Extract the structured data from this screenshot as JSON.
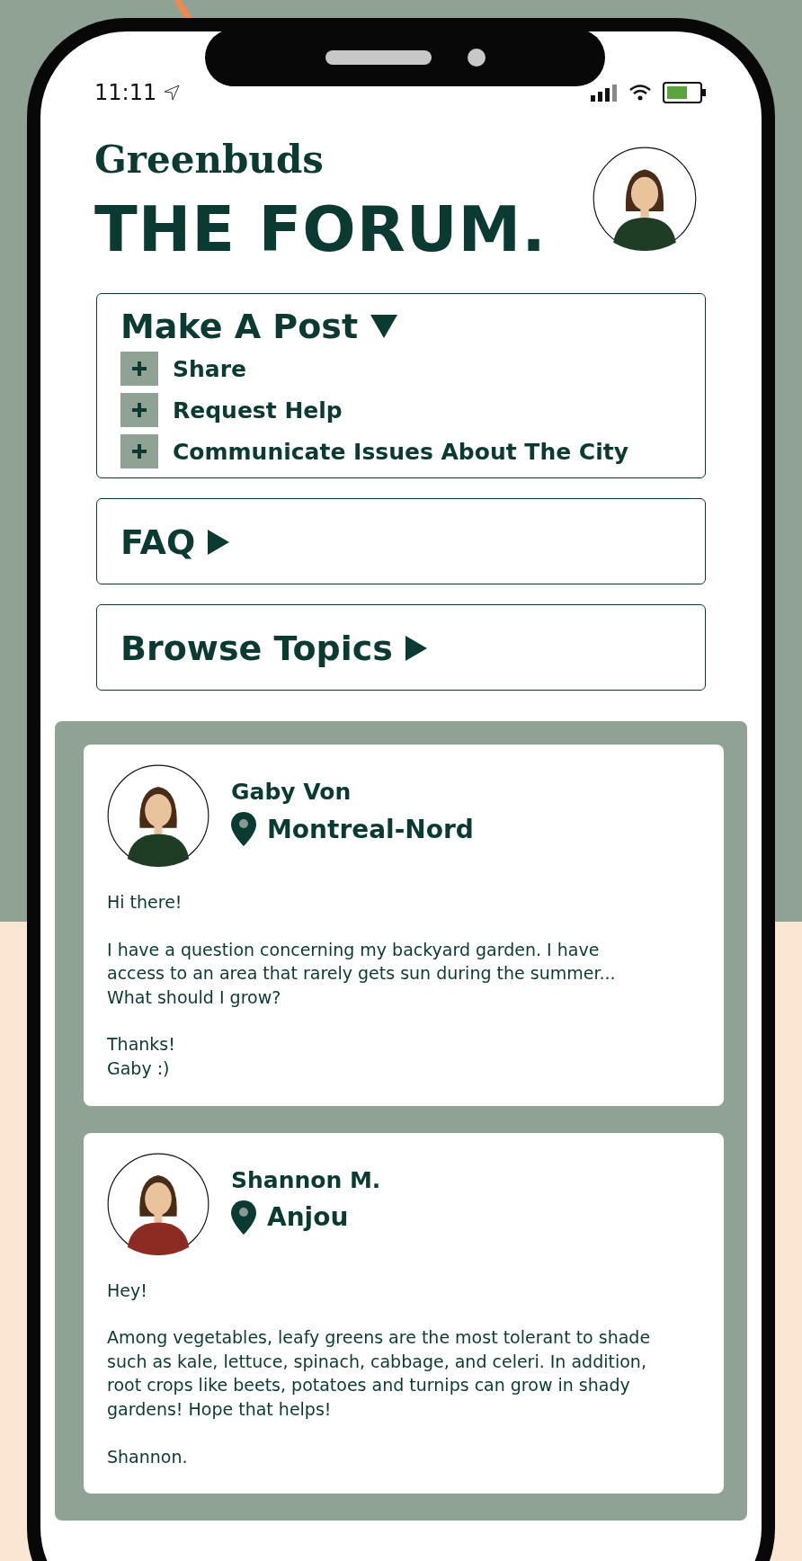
{
  "status_bar": {
    "time": "11:11"
  },
  "brand": "Greenbuds",
  "title": "THE FORUM.",
  "sections": [
    {
      "label": "Make A Post",
      "expanded": true,
      "children": [
        {
          "label": "Share"
        },
        {
          "label": "Request Help"
        },
        {
          "label": "Communicate Issues About The City"
        }
      ]
    },
    {
      "label": "FAQ",
      "expanded": false
    },
    {
      "label": "Browse Topics",
      "expanded": false
    }
  ],
  "posts": [
    {
      "author": "Gaby Von",
      "location": "Montreal-Nord",
      "color": "#1f3d24",
      "paragraphs": [
        "Hi there!",
        "I have a question concerning my backyard garden. I have access to an area that rarely gets sun during the summer... What should I grow?",
        "Thanks!\nGaby :)"
      ]
    },
    {
      "author": "Shannon M.",
      "location": "Anjou",
      "color": "#8c2b22",
      "paragraphs": [
        "Hey!",
        "Among vegetables, leafy greens are the most tolerant to shade such as kale, lettuce, spinach, cabbage, and celeri. In addition, root crops like beets, potatoes and turnips can grow in shady gardens! Hope that helps!",
        "Shannon."
      ]
    }
  ]
}
